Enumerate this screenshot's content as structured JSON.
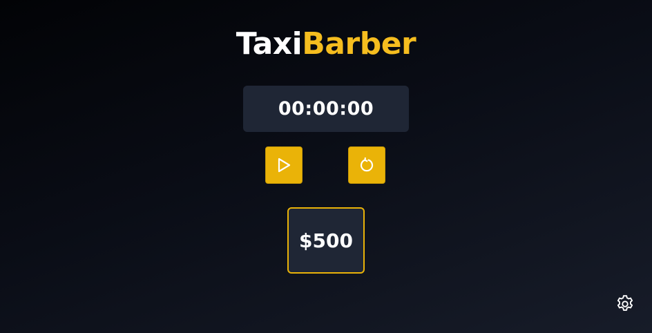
{
  "header": {
    "title_part1": "Taxi",
    "title_part2": "Barber"
  },
  "timer": {
    "display": "00:00:00"
  },
  "controls": {
    "play_icon": "play-icon",
    "reset_icon": "refresh-icon"
  },
  "price": {
    "label": "$500"
  },
  "settings": {
    "icon": "gear-icon"
  },
  "colors": {
    "accent": "#eab308",
    "title_accent": "#f5bd1f",
    "panel": "#1f2635",
    "text": "#ffffff"
  }
}
